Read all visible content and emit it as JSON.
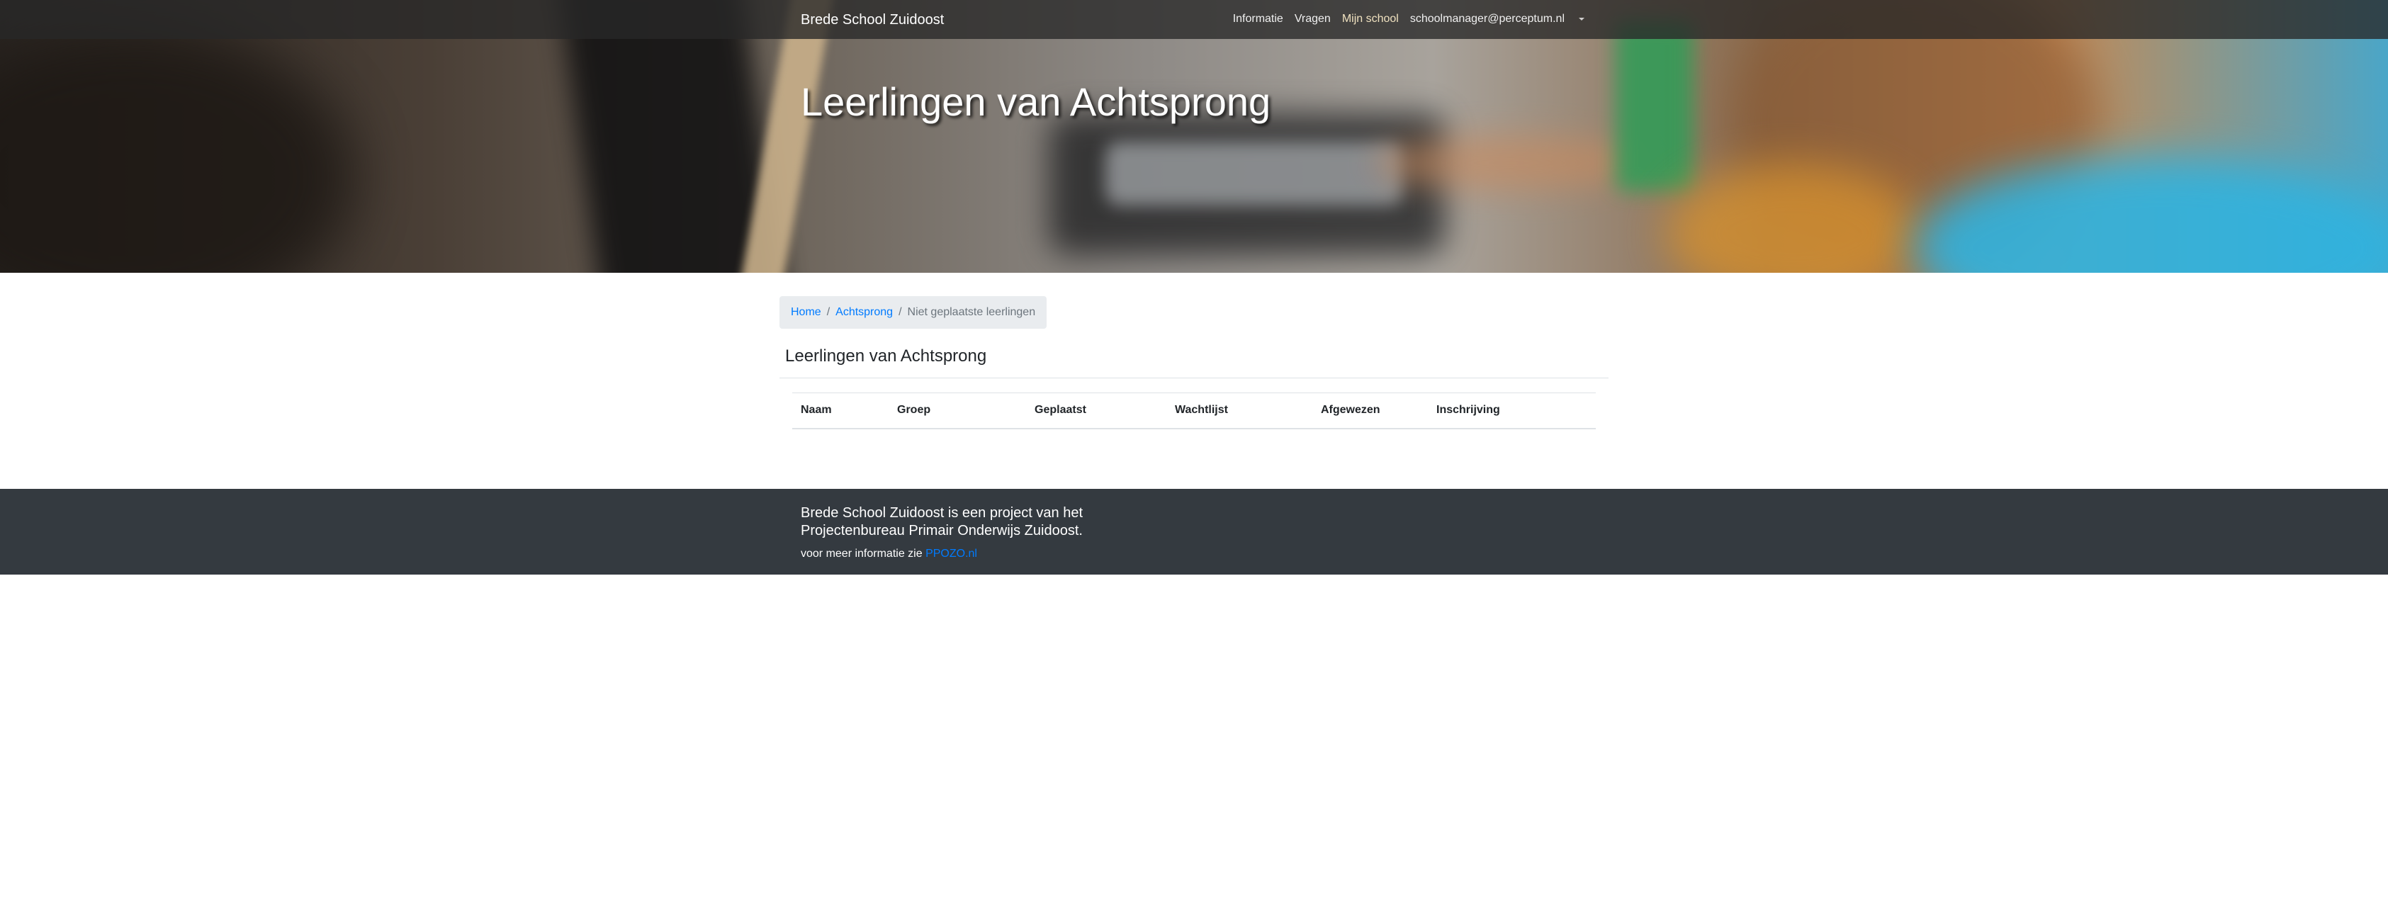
{
  "header": {
    "brand": "Brede School Zuidoost",
    "nav": [
      {
        "label": "Informatie",
        "active": false
      },
      {
        "label": "Vragen",
        "active": false
      },
      {
        "label": "Mijn school",
        "active": true
      },
      {
        "label": "schoolmanager@perceptum.nl",
        "active": false
      }
    ],
    "hero_title": "Leerlingen van Achtsprong"
  },
  "breadcrumb": {
    "home": "Home",
    "school": "Achtsprong",
    "current": "Niet geplaatste leerlingen",
    "separator": "/"
  },
  "main": {
    "heading": "Leerlingen van Achtsprong",
    "table": {
      "columns": [
        "Naam",
        "Groep",
        "Geplaatst",
        "Wachtlijst",
        "Afgewezen",
        "Inschrijving"
      ],
      "rows": []
    }
  },
  "footer": {
    "text": "Brede School Zuidoost is een project van het Projectenbureau Primair Onderwijs Zuidoost.",
    "more_prefix": "voor meer informatie zie",
    "more_link": "PPOZO.nl"
  },
  "colors": {
    "link": "#007bff",
    "footer_bg": "#343a40",
    "breadcrumb_bg": "#e9ecef",
    "nav_active": "#f0e2c0"
  }
}
